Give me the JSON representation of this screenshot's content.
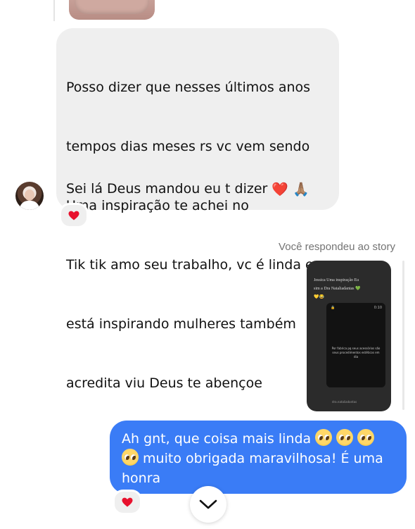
{
  "thread": {
    "incoming_message": {
      "lines": [
        "Posso dizer que nesses últimos anos",
        "tempos dias meses rs vc vem sendo",
        "Uma inspiração te achei no",
        "Tik tik amo seu trabalho, vc é linda e",
        "está inspirando mulheres também",
        "acredita viu Deus te abençoe"
      ],
      "last_line_text": "Sei lá Deus mandou eu t dizer ",
      "last_line_emojis": [
        "❤️",
        "🙏🏽"
      ],
      "reaction": "❤️"
    },
    "story_reply": {
      "label": "Você respondeu ao story",
      "story_caption_line1": "Jessica Uma inspiração Eu",
      "story_caption_line2": "sim a Dra Nataliadantas 💚",
      "story_caption_line3": "💛😂",
      "story_phone_left": "🔒",
      "story_phone_time": "0:10",
      "story_phone_text": "Por fabrica pq seus acessórios são seus procedimentos estéticos em dia",
      "story_bottom_text": "dra.nataliadantas"
    },
    "outgoing_message": {
      "part1": "Ah gnt, que coisa mais linda ",
      "part2": " muito obrigada maravilhosa! É uma",
      "part3": "honra",
      "reaction": "❤️"
    }
  },
  "colors": {
    "incoming_bubble": "#efefef",
    "outgoing_bubble": "#3a7cf6",
    "meta_text": "#737373"
  },
  "icons": {
    "scroll_down": "chevron-down-icon",
    "heart": "heart-icon",
    "pleading": "pleading-face-icon"
  }
}
